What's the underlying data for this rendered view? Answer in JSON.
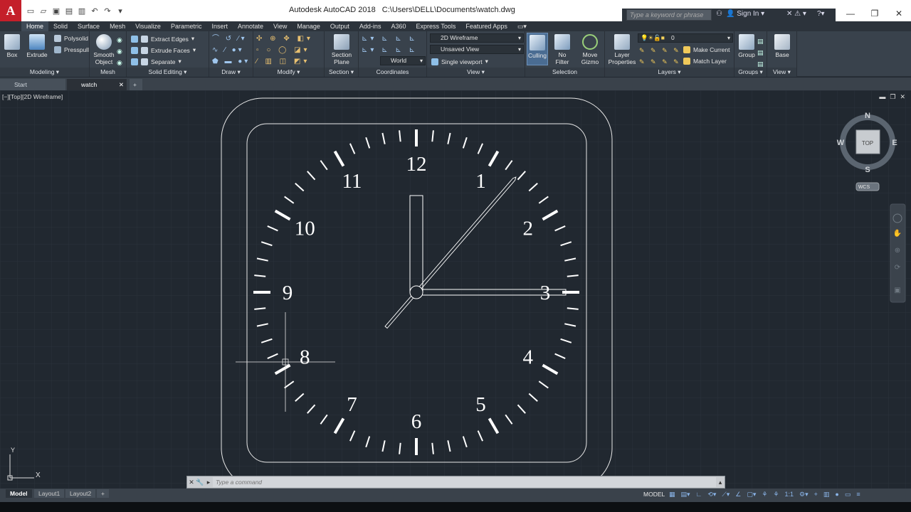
{
  "app": {
    "logo": "A",
    "title": "Autodesk AutoCAD 2018",
    "path": "C:\\Users\\DELL\\Documents\\watch.dwg",
    "search_placeholder": "Type a keyword or phrase",
    "sign_in": "Sign In"
  },
  "menu_tabs": [
    "Home",
    "Solid",
    "Surface",
    "Mesh",
    "Visualize",
    "Parametric",
    "Insert",
    "Annotate",
    "View",
    "Manage",
    "Output",
    "Add-ins",
    "A360",
    "Express Tools",
    "Featured Apps"
  ],
  "ribbon": {
    "modeling": {
      "label": "Modeling",
      "box": "Box",
      "extrude": "Extrude",
      "polysolid": "Polysolid",
      "presspull": "Presspull"
    },
    "mesh": {
      "label": "Mesh",
      "smooth_object": "Smooth Object"
    },
    "solid_editing": {
      "label": "Solid Editing",
      "extract_edges": "Extract Edges",
      "extrude_faces": "Extrude Faces",
      "separate": "Separate"
    },
    "draw": {
      "label": "Draw"
    },
    "modify": {
      "label": "Modify"
    },
    "section": {
      "label": "Section",
      "section_plane": "Section Plane"
    },
    "coordinates": {
      "label": "Coordinates",
      "world": "World"
    },
    "view": {
      "label": "View",
      "visual_style": "2D Wireframe",
      "named_view": "Unsaved View",
      "viewport": "Single viewport"
    },
    "selection": {
      "label": "Selection",
      "culling": "Culling",
      "no_filter": "No Filter",
      "move_gizmo": "Move Gizmo"
    },
    "layers": {
      "label": "Layers",
      "layer_properties": "Layer Properties",
      "current_layer": "0",
      "make_current": "Make Current",
      "match_layer": "Match Layer"
    },
    "groups": {
      "label": "Groups",
      "group": "Group"
    },
    "view2": {
      "label": "View",
      "base": "Base"
    }
  },
  "doc_tabs": [
    "Start",
    "watch"
  ],
  "viewport_label": "[−][Top][2D Wireframe]",
  "viewcube": {
    "n": "N",
    "s": "S",
    "e": "E",
    "w": "W",
    "face": "TOP",
    "wcs": "WCS"
  },
  "ucs": {
    "x": "X",
    "y": "Y"
  },
  "clock": {
    "numbers": [
      "12",
      "1",
      "2",
      "3",
      "4",
      "5",
      "6",
      "7",
      "8",
      "9",
      "10",
      "11"
    ],
    "hour_hand_hours": 3.0,
    "minute_hand_minutes": 0,
    "second_hand_seconds": 6.8
  },
  "command_line": {
    "placeholder": "Type a command"
  },
  "layout_tabs": [
    "Model",
    "Layout1",
    "Layout2"
  ],
  "status": {
    "model": "MODEL",
    "scale": "1:1"
  }
}
